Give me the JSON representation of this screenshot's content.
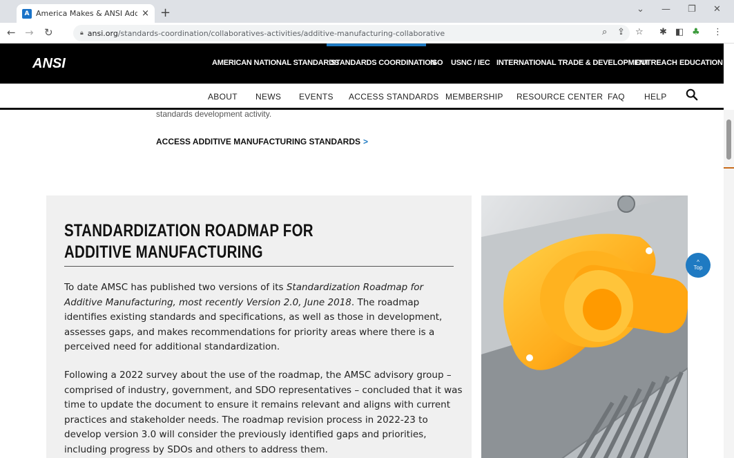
{
  "browser": {
    "tab_title": "America Makes & ANSI Additive",
    "tab_close": "×",
    "new_tab": "+",
    "url_domain": "ansi.org",
    "url_path": "/standards-coordination/collaboratives-activities/additive-manufacturing-collaborative"
  },
  "site": {
    "logo": "ANSI",
    "top_nav": [
      "AMERICAN NATIONAL STANDARDS",
      "STANDARDS COORDINATION",
      "ISO",
      "USNC / IEC",
      "INTERNATIONAL TRADE & DEVELOPMENT",
      "OUTREACH",
      "EDUCATION"
    ],
    "active_top_nav": "STANDARDS COORDINATION",
    "sub_nav": [
      "ABOUT",
      "NEWS",
      "EVENTS",
      "ACCESS STANDARDS",
      "MEMBERSHIP",
      "RESOURCE CENTER",
      "FAQ",
      "HELP"
    ]
  },
  "content": {
    "cut_text": "standards development activity.",
    "access_link": "ACCESS ADDITIVE MANUFACTURING STANDARDS",
    "access_arrow": ">",
    "card_title": "STANDARDIZATION ROADMAP FOR ADDITIVE MANUFACTURING",
    "p1_a": "To date AMSC has published two versions of its ",
    "p1_italic": "Standardization Roadmap for Additive Manufacturing, most recently Version 2.0, June 2018",
    "p1_b": ". The roadmap identifies existing standards and specifications, as well as those in development, assesses gaps, and makes recommendations for priority areas where there is a perceived need for additional standardization.",
    "p2": "Following a 2022 survey about the use of the roadmap, the AMSC advisory group – comprised of industry, government, and SDO representatives – concluded that it was time to update the document to ensure it remains relevant and aligns with current practices and stakeholder needs. The roadmap revision process in 2022-23 to develop version 3.0 will consider the previously identified gaps and priorities, including progress by SDOs and others to address them.",
    "top_button": "Top"
  },
  "colors": {
    "accent": "#1f7ac2",
    "nav_bg": "#000000",
    "card_bg": "#f0f0f0"
  }
}
